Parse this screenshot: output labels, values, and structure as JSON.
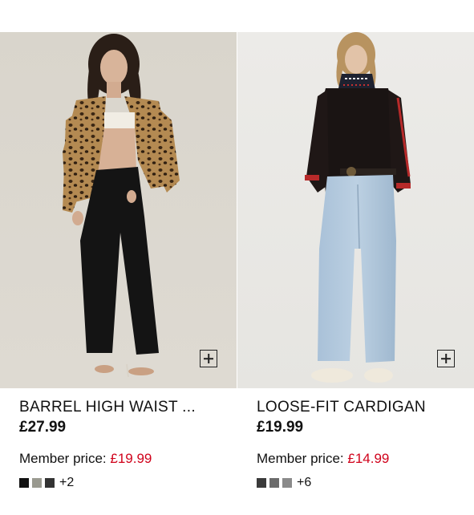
{
  "products": [
    {
      "title": "BARREL HIGH WAIST ...",
      "price": "£27.99",
      "member_label": "Member price: ",
      "member_price": "£19.99",
      "swatch_colors": [
        "#111111",
        "#9a9a90",
        "#333333"
      ],
      "more_colors": "+2",
      "image_icon": "model-leopard-jacket-black-jeans"
    },
    {
      "title": "LOOSE-FIT CARDIGAN",
      "price": "£19.99",
      "member_label": "Member price: ",
      "member_price": "£14.99",
      "swatch_colors": [
        "#3a3a3a",
        "#6b6b6b",
        "#8a8a8a"
      ],
      "more_colors": "+6",
      "image_icon": "model-black-cardigan-blue-jeans"
    }
  ],
  "colors": {
    "member_price": "#d0021b",
    "text": "#111111"
  }
}
